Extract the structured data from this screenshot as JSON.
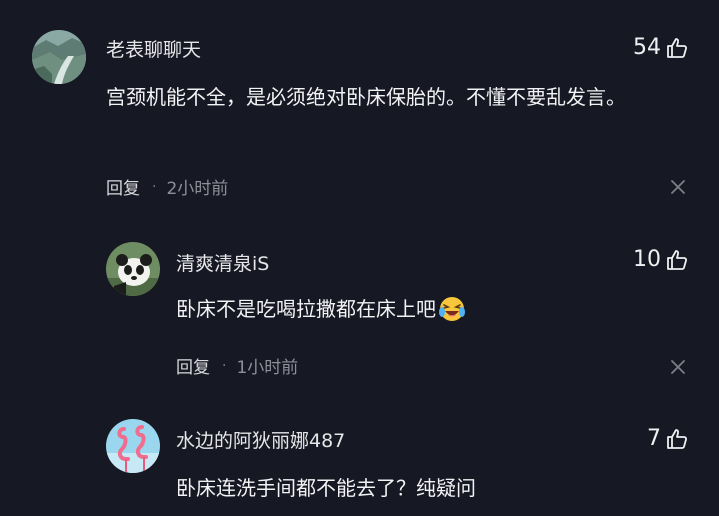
{
  "comments": [
    {
      "username": "老表聊聊天",
      "likes": "54",
      "text": "宫颈机能不全，是必须绝对卧床保胎的。不懂不要乱发言。",
      "reply_label": "回复",
      "separator": "·",
      "time": "2小时前",
      "avatar_icon": "landscape-avatar",
      "like_icon": "thumbs-up-icon",
      "close_icon": "close-icon"
    },
    {
      "username": "清爽清泉iS",
      "likes": "10",
      "text": "卧床不是吃喝拉撒都在床上吧",
      "emoji_icon": "laughing-crying-emoji",
      "reply_label": "回复",
      "separator": "·",
      "time": "1小时前",
      "avatar_icon": "panda-avatar",
      "like_icon": "thumbs-up-icon",
      "close_icon": "close-icon"
    },
    {
      "username": "水边的阿狄丽娜487",
      "likes": "7",
      "text": "卧床连洗手间都不能去了？纯疑问",
      "avatar_icon": "flamingo-avatar",
      "like_icon": "thumbs-up-icon"
    }
  ],
  "colors": {
    "background": "#161823",
    "text_primary": "#f3f3f5",
    "text_secondary": "#8e9099"
  }
}
